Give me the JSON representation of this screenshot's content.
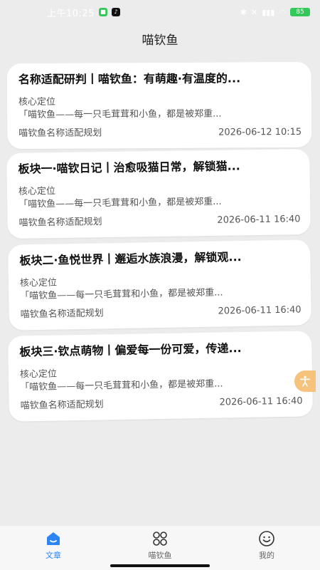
{
  "status_bar": {
    "time": "上午10:25",
    "battery": "85"
  },
  "header": {
    "title": "喵钦鱼"
  },
  "articles": [
    {
      "title": "名称适配研判丨喵钦鱼：有萌趣·有温度的...",
      "section": "核心定位",
      "summary": "「喵钦鱼——每一只毛茸茸和小鱼，都是被郑重...",
      "category": "喵钦鱼名称适配规划",
      "date": "2026-06-12 10:15"
    },
    {
      "title": "板块一·喵钦日记丨治愈吸猫日常，解锁猫...",
      "section": "核心定位",
      "summary": "「喵钦鱼——每一只毛茸茸和小鱼，都是被郑重...",
      "category": "喵钦鱼名称适配规划",
      "date": "2026-06-11 16:40"
    },
    {
      "title": "板块二·鱼悦世界丨邂逅水族浪漫，解锁观...",
      "section": "核心定位",
      "summary": "「喵钦鱼——每一只毛茸茸和小鱼，都是被郑重...",
      "category": "喵钦鱼名称适配规划",
      "date": "2026-06-11 16:40"
    },
    {
      "title": "板块三·钦点萌物丨偏爱每一份可爱，传递...",
      "section": "核心定位",
      "summary": "「喵钦鱼——每一只毛茸茸和小鱼，都是被郑重...",
      "category": "喵钦鱼名称适配规划",
      "date": "2026-06-11 16:40"
    }
  ],
  "bottom_nav": {
    "items": [
      {
        "label": "文章",
        "icon": "home-icon",
        "active": true
      },
      {
        "label": "喵钦鱼",
        "icon": "grid-icon",
        "active": false
      },
      {
        "label": "我的",
        "icon": "smiley-icon",
        "active": false
      }
    ]
  },
  "colors": {
    "accent": "#2b86f3",
    "float_button": "#f6c37c"
  }
}
